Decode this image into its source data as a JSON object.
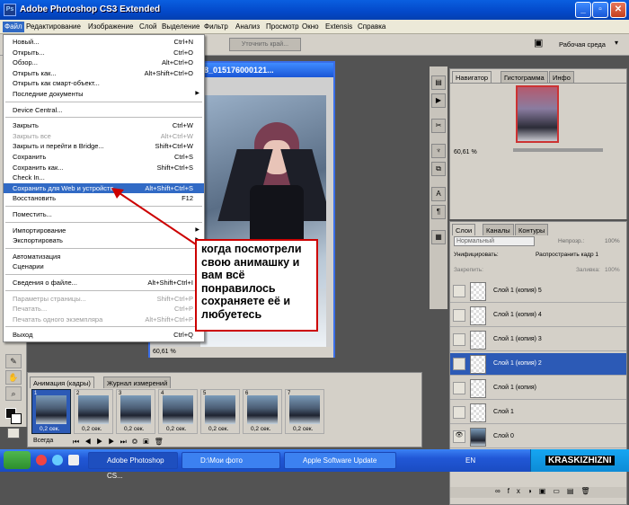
{
  "app": {
    "title": "Adobe Photoshop CS3 Extended",
    "icon_text": "Ps"
  },
  "menubar": [
    "Файл",
    "Редактирование",
    "Изображение",
    "Слой",
    "Выделение",
    "Фильтр",
    "Анализ",
    "Просмотр",
    "Окно",
    "Extensis",
    "Справка"
  ],
  "options": {
    "refine_label": "Уточнить край...",
    "workspace_label": "Рабочая среда"
  },
  "document": {
    "title": "8_015176000121...",
    "zoom": "60,61 %"
  },
  "file_menu": [
    {
      "label": "Новый...",
      "shortcut": "Ctrl+N"
    },
    {
      "label": "Открыть...",
      "shortcut": "Ctrl+O"
    },
    {
      "label": "Обзор...",
      "shortcut": "Alt+Ctrl+O"
    },
    {
      "label": "Открыть как...",
      "shortcut": "Alt+Shift+Ctrl+O"
    },
    {
      "label": "Открыть как смарт-объект...",
      "shortcut": ""
    },
    {
      "label": "Последние документы",
      "shortcut": "",
      "submenu": true
    },
    {
      "label": "Device Central...",
      "shortcut": ""
    },
    {
      "label": "Закрыть",
      "shortcut": "Ctrl+W"
    },
    {
      "label": "Закрыть все",
      "shortcut": "Alt+Ctrl+W",
      "disabled": true
    },
    {
      "label": "Закрыть и перейти в Bridge...",
      "shortcut": "Shift+Ctrl+W"
    },
    {
      "label": "Сохранить",
      "shortcut": "Ctrl+S"
    },
    {
      "label": "Сохранить как...",
      "shortcut": "Shift+Ctrl+S"
    },
    {
      "label": "Check In...",
      "shortcut": ""
    },
    {
      "label": "Сохранить для Web и устройств...",
      "shortcut": "Alt+Shift+Ctrl+S",
      "highlighted": true
    },
    {
      "label": "Восстановить",
      "shortcut": "F12"
    },
    {
      "label": "Поместить...",
      "shortcut": ""
    },
    {
      "label": "Импортирование",
      "shortcut": "",
      "submenu": true
    },
    {
      "label": "Экспортировать",
      "shortcut": "",
      "submenu": true
    },
    {
      "label": "Автоматизация",
      "shortcut": "",
      "submenu": true
    },
    {
      "label": "Сценарии",
      "shortcut": "",
      "submenu": true
    },
    {
      "label": "Сведения о файле...",
      "shortcut": "Alt+Shift+Ctrl+I"
    },
    {
      "label": "Параметры страницы...",
      "shortcut": "Shift+Ctrl+P",
      "disabled": true
    },
    {
      "label": "Печатать...",
      "shortcut": "Ctrl+P",
      "disabled": true
    },
    {
      "label": "Печатать одного экземпляра",
      "shortcut": "Alt+Shift+Ctrl+P",
      "disabled": true
    },
    {
      "label": "Выход",
      "shortcut": "Ctrl+Q"
    }
  ],
  "callout": "когда посмотрели свою анимашку и вам всё понравилось сохраняете её и любуетесь",
  "navigator": {
    "tabs": [
      "Навигатор",
      "Гистограмма",
      "Инфо"
    ],
    "zoom": "60,61 %"
  },
  "layers_panel": {
    "tabs": [
      "Слои",
      "Каналы",
      "Контуры"
    ],
    "blend_mode": "Нормальный",
    "opacity_label": "Непрозр.:",
    "opacity_value": "100%",
    "unify_label": "Унифицировать:",
    "propagate_label": "Распространить кадр 1",
    "lock_label": "Закрепить:",
    "fill_label": "Заливка:",
    "fill_value": "100%",
    "layers": [
      {
        "name": "Слой 1 (копия) 5"
      },
      {
        "name": "Слой 1 (копия) 4"
      },
      {
        "name": "Слой 1 (копия) 3"
      },
      {
        "name": "Слой 1 (копия) 2",
        "selected": true
      },
      {
        "name": "Слой 1 (копия)"
      },
      {
        "name": "Слой 1"
      },
      {
        "name": "Слой 0",
        "visible": true
      }
    ]
  },
  "animation": {
    "tabs": [
      "Анимация (кадры)",
      "Журнал измерений"
    ],
    "frames": [
      {
        "num": "1",
        "delay": "0,2 сек."
      },
      {
        "num": "2",
        "delay": "0,2 сек."
      },
      {
        "num": "3",
        "delay": "0,2 сек."
      },
      {
        "num": "4",
        "delay": "0,2 сек."
      },
      {
        "num": "5",
        "delay": "0,2 сек."
      },
      {
        "num": "6",
        "delay": "0,2 сек."
      },
      {
        "num": "7",
        "delay": "0,2 сек."
      }
    ],
    "loop": "Всегда"
  },
  "taskbar": {
    "items": [
      "Adobe Photoshop CS...",
      "D:\\Мои фото",
      "Apple Software Update"
    ],
    "lang": "EN",
    "watermark": "KRASKIZHIZNI"
  },
  "colors": {
    "accent": "#316ac5",
    "callout_border": "#cc0000",
    "arrow": "#cc0000"
  }
}
